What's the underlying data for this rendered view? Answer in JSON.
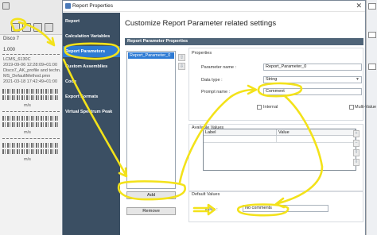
{
  "background_app": {
    "tab_label": "Disco 7",
    "value": "1.000",
    "meta_lines": [
      "LCMS_6130C",
      "2019-09-06 12:28:09+01:00",
      "Disco7_AK_profile and techn.",
      "MS_DefaultMethod.pmn",
      "2021-03-18 17:42:49+01:00"
    ],
    "axis_label": "m/s",
    "icons": [
      "home-icon",
      "folder-icon",
      "gear-icon",
      "grid-icon"
    ]
  },
  "dialog": {
    "title": "Report Properties",
    "close_glyph": "✕",
    "nav_items": [
      {
        "label": "Report",
        "active": false
      },
      {
        "label": "Calculation Variables",
        "active": false
      },
      {
        "label": "Report Parameters",
        "active": true
      },
      {
        "label": "Custom Assemblies",
        "active": false
      },
      {
        "label": "Code",
        "active": false
      },
      {
        "label": "Export Formats",
        "active": false
      },
      {
        "label": "Virtual Spectrum Peak",
        "active": false
      }
    ],
    "heading": "Customize Report Parameter related settings",
    "section_title": "Report Parameter Properties",
    "parameters": [
      "Report_Parameter_0"
    ],
    "move_up_glyph": "⇧",
    "move_down_glyph": "⇩",
    "add_label": "Add",
    "remove_label": "Remove",
    "properties_group": "Properties",
    "parameter_name_label": "Parameter name :",
    "parameter_name_value": "Report_Parameter_0",
    "data_type_label": "Data type :",
    "data_type_value": "String",
    "prompt_name_label": "Prompt name :",
    "prompt_name_value": "Comment",
    "internal_label": "Internal",
    "multi_value_label": "Multi-Value",
    "available_values_group": "Available Values",
    "table_headers": [
      "Label",
      "Value"
    ],
    "table_side_glyphs": [
      "+",
      "−",
      "⇧",
      "⇩"
    ],
    "default_values_group": "Default Values",
    "value_label": "Value :",
    "value_value": "No comments"
  },
  "colors": {
    "nav_bg": "#3b4f63",
    "nav_active": "#2e7bd4",
    "annotation": "#f3e21a"
  }
}
